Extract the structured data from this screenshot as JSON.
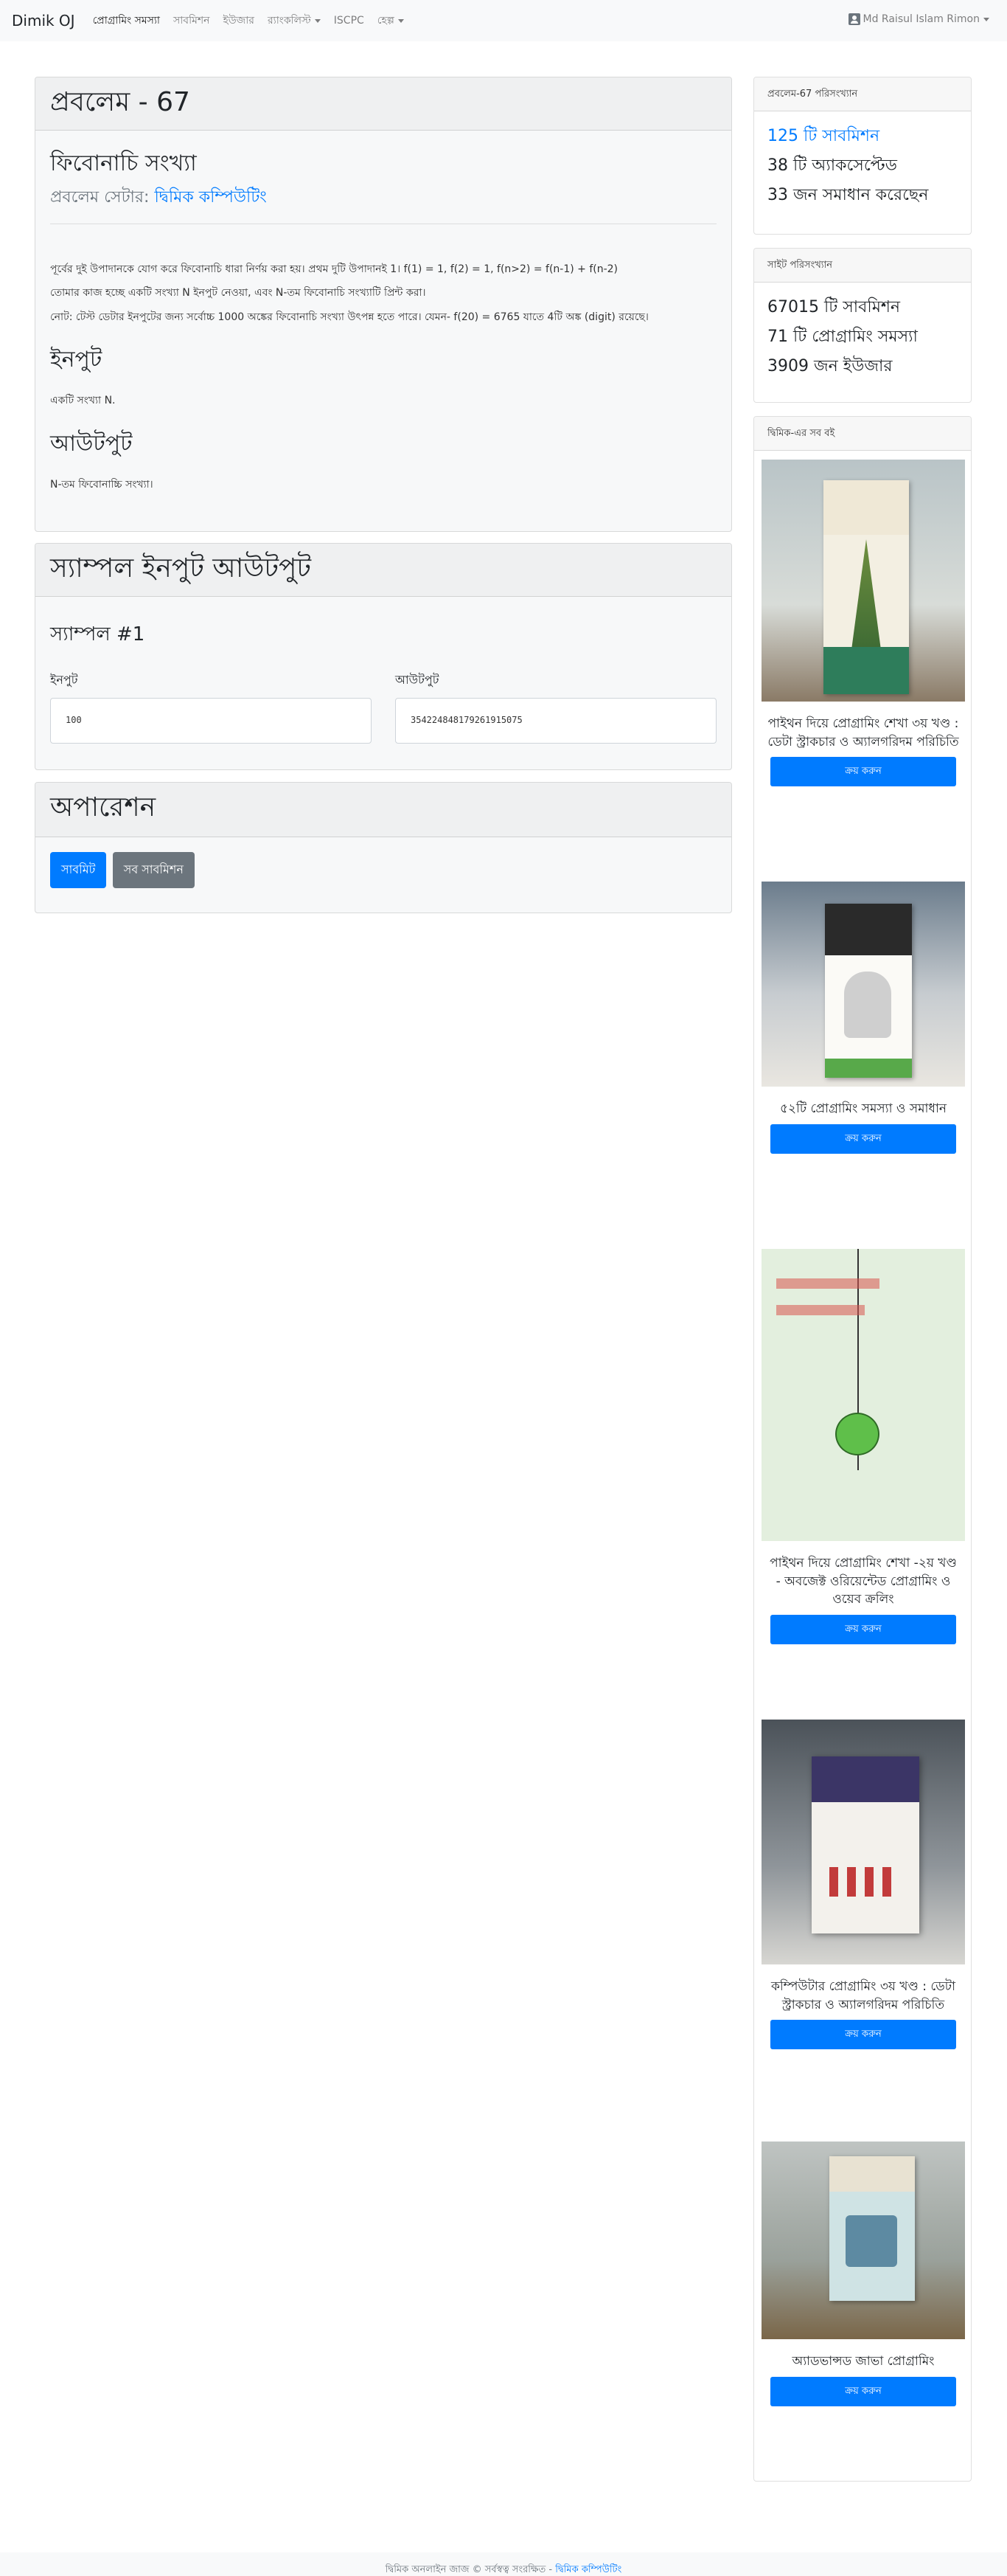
{
  "navbar": {
    "brand": "Dimik OJ",
    "links": [
      {
        "label": "প্রোগ্রামিং সমস্যা",
        "active": true
      },
      {
        "label": "সাবমিশন"
      },
      {
        "label": "ইউজার"
      },
      {
        "label": "র‍্যাংকলিস্ট",
        "dropdown": true
      },
      {
        "label": "ISCPC"
      },
      {
        "label": "হেল্প",
        "dropdown": true
      }
    ],
    "user": "Md Raisul Islam Rimon"
  },
  "problem": {
    "header": "প্রবলেম - 67",
    "title": "ফিবোনাচি সংখ্যা",
    "setter_label": "প্রবলেম সেটার:",
    "setter_name": "দ্বিমিক কম্পিউটিং",
    "description": [
      "পূর্বের দুই উপাদানকে যোগ করে ফিবোনাচি ধারা নির্ণয় করা হয়। প্রথম দুটি উপাদানই 1। f(1) = 1, f(2) = 1, f(n>2) = f(n-1) + f(n-2)",
      "তোমার কাজ হচ্ছে একটি সংখ্যা N ইনপুট নেওয়া, এবং N-তম ফিবোনাচি সংখ্যাটি প্রিন্ট করা।",
      "নোট: টেস্ট ডেটার ইনপুটের জন্য সর্বোচ্চ 1000 অঙ্কের ফিবোনাচি সংখ্যা উৎপন্ন হতে পারে। যেমন- f(20) = 6765 যাতে 4টি অঙ্ক (digit) রয়েছে।"
    ],
    "input_heading": "ইনপুট",
    "input_text": "একটি সংখ্যা N.",
    "output_heading": "আউটপুট",
    "output_text": "N-তম ফিবোনাচ্চি সংখ্যা।"
  },
  "samples": {
    "header": "স্যাম্পল ইনপুট আউটপুট",
    "sample_title": "স্যাম্পল #1",
    "input_label": "ইনপুট",
    "output_label": "আউটপুট",
    "input_value": "100",
    "output_value": "354224848179261915075"
  },
  "operations": {
    "header": "অপারেশন",
    "submit_label": "সাবমিট",
    "all_submissions_label": "সব সাবমিশন"
  },
  "problem_stats": {
    "header": "প্রবলেম-67 পরিসংখ্যান",
    "submissions": "125 টি সাবমিশন",
    "accepted": "38 টি অ্যাকসেপ্টেড",
    "solved_by": "33 জন সমাধান করেছেন"
  },
  "site_stats": {
    "header": "সাইট পরিসংখ্যান",
    "submissions": "67015 টি সাবমিশন",
    "problems": "71 টি প্রোগ্রামিং সমস্যা",
    "users": "3909 জন ইউজার"
  },
  "books": {
    "header": "দ্বিমিক-এর সব বই",
    "buy_label": "ক্রয় করুন",
    "items": [
      {
        "title": "পাইথন দিয়ে প্রোগ্রামিং শেখা ৩য় খণ্ড : ডেটা স্ট্রাকচার ও অ্যালগরিদম পরিচিতি"
      },
      {
        "title": "৫২টি প্রোগ্রামিং সমস্যা ও সমাধান"
      },
      {
        "title": "পাইথন দিয়ে প্রোগ্রামিং শেখা -২য় খণ্ড - অবজেক্ট ওরিয়েন্টেড প্রোগ্রামিং ও ওয়েব ক্রলিং"
      },
      {
        "title": "কম্পিউটার প্রোগ্রামিং ৩য় খণ্ড : ডেটা স্ট্রাকচার ও অ্যালগরিদম পরিচিতি"
      },
      {
        "title": "অ্যাডভান্সড জাভা প্রোগ্রামিং"
      }
    ]
  },
  "footer": {
    "text": "দ্বিমিক অনলাইন জাজ © সর্বস্বত্ব সংরক্ষিত -",
    "link": "দ্বিমিক কম্পিউটিং"
  },
  "colors": {
    "primary": "#007bff",
    "secondary": "#6c757d",
    "navbar": "#f8f9fa"
  }
}
